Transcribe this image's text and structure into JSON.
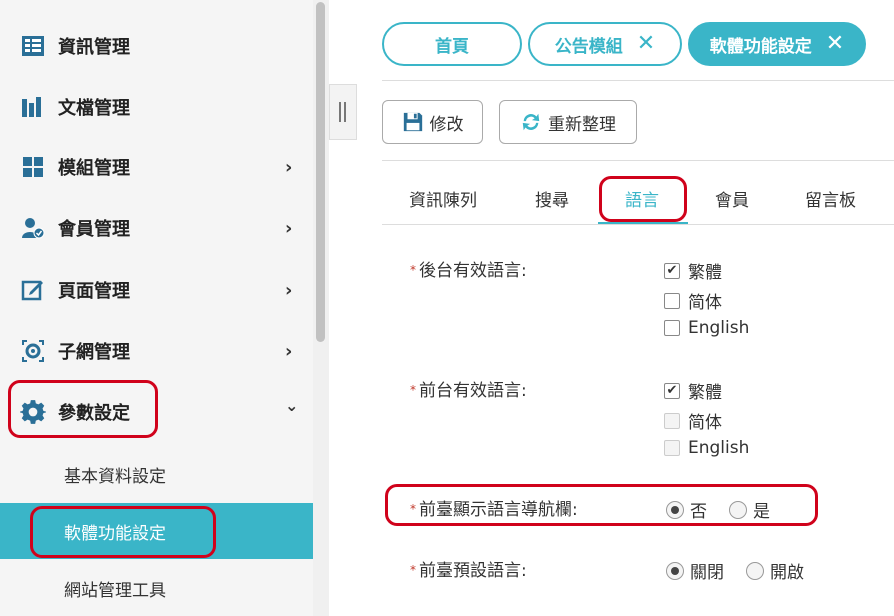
{
  "sidebar": {
    "items": [
      {
        "label": "資訊管理",
        "icon": "info-grid-icon",
        "has_chevron": false
      },
      {
        "label": "文檔管理",
        "icon": "document-bars-icon",
        "has_chevron": false
      },
      {
        "label": "模組管理",
        "icon": "modules-grid-icon",
        "has_chevron": true
      },
      {
        "label": "會員管理",
        "icon": "member-check-icon",
        "has_chevron": true
      },
      {
        "label": "頁面管理",
        "icon": "edit-page-icon",
        "has_chevron": true
      },
      {
        "label": "子網管理",
        "icon": "subnet-icon",
        "has_chevron": true
      },
      {
        "label": "參數設定",
        "icon": "gear-icon",
        "has_chevron": true,
        "expanded": true
      }
    ],
    "subitems": [
      {
        "label": "基本資料設定",
        "active": false
      },
      {
        "label": "軟體功能設定",
        "active": true
      },
      {
        "label": "網站管理工具",
        "active": false
      }
    ],
    "chevron_right": "›",
    "chevron_down": "⌄"
  },
  "tabs": [
    {
      "label": "首頁",
      "closable": false,
      "active": false
    },
    {
      "label": "公告模組",
      "closable": true,
      "active": false
    },
    {
      "label": "軟體功能設定",
      "closable": true,
      "active": true
    }
  ],
  "toolbar": {
    "edit_label": "修改",
    "refresh_label": "重新整理"
  },
  "subtabs": [
    {
      "label": "資訊陳列",
      "active": false
    },
    {
      "label": "搜尋",
      "active": false
    },
    {
      "label": "語言",
      "active": true
    },
    {
      "label": "會員",
      "active": false
    },
    {
      "label": "留言板",
      "active": false
    }
  ],
  "form": {
    "backend_lang": {
      "label": "後台有效語言:",
      "options": [
        {
          "label": "繁體",
          "checked": true,
          "disabled": false
        },
        {
          "label": "简体",
          "checked": false,
          "disabled": false
        },
        {
          "label": "English",
          "checked": false,
          "disabled": false
        }
      ]
    },
    "frontend_lang": {
      "label": "前台有效語言:",
      "options": [
        {
          "label": "繁體",
          "checked": true,
          "disabled": false
        },
        {
          "label": "简体",
          "checked": false,
          "disabled": true
        },
        {
          "label": "English",
          "checked": false,
          "disabled": true
        }
      ]
    },
    "lang_nav": {
      "label": "前臺顯示語言導航欄:",
      "options": [
        {
          "label": "否",
          "selected": true
        },
        {
          "label": "是",
          "selected": false
        }
      ]
    },
    "default_lang": {
      "label": "前臺預設語言:",
      "options": [
        {
          "label": "關閉",
          "selected": true
        },
        {
          "label": "開啟",
          "selected": false
        }
      ]
    },
    "required_mark": "*"
  },
  "colors": {
    "accent": "#3ab5c8",
    "highlight_box": "#d0021b",
    "sidebar_bg": "#f5f5f5",
    "icon_blue": "#2a6f97"
  }
}
